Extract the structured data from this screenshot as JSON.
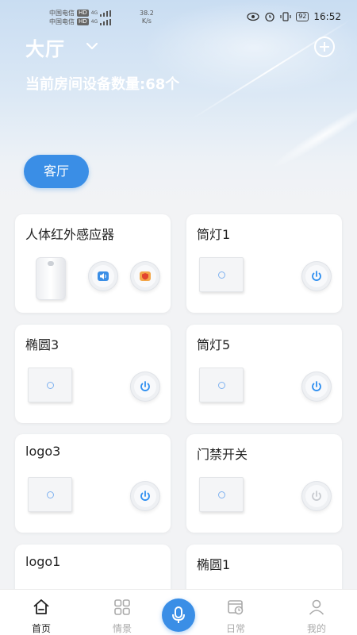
{
  "status_bar": {
    "carrier1": "中国电信",
    "carrier2": "中国电信",
    "hd": "HD",
    "net1": "4G",
    "net2": "4G",
    "speed_value": "38.2",
    "speed_unit": "K/s",
    "battery": "92",
    "time": "16:52"
  },
  "header": {
    "room_name": "大厅",
    "device_count": "当前房间设备数量:68个"
  },
  "room_tab": {
    "label": "客厅"
  },
  "devices": [
    {
      "name": "人体红外感应器",
      "type": "sensor"
    },
    {
      "name": "筒灯1",
      "type": "switch",
      "state": "on"
    },
    {
      "name": "椭圆3",
      "type": "switch",
      "state": "on"
    },
    {
      "name": "筒灯5",
      "type": "switch",
      "state": "on"
    },
    {
      "name": "logo3",
      "type": "switch",
      "state": "on"
    },
    {
      "name": "门禁开关",
      "type": "switch",
      "state": "off"
    },
    {
      "name": "logo1",
      "type": "switch"
    },
    {
      "name": "椭圆1",
      "type": "switch"
    }
  ],
  "bottom_nav": {
    "home": "首页",
    "scene": "情景",
    "daily": "日常",
    "mine": "我的"
  },
  "colors": {
    "accent": "#3a8ee6",
    "power_on": "#2f8ff0",
    "power_off": "#c8cbd0"
  }
}
